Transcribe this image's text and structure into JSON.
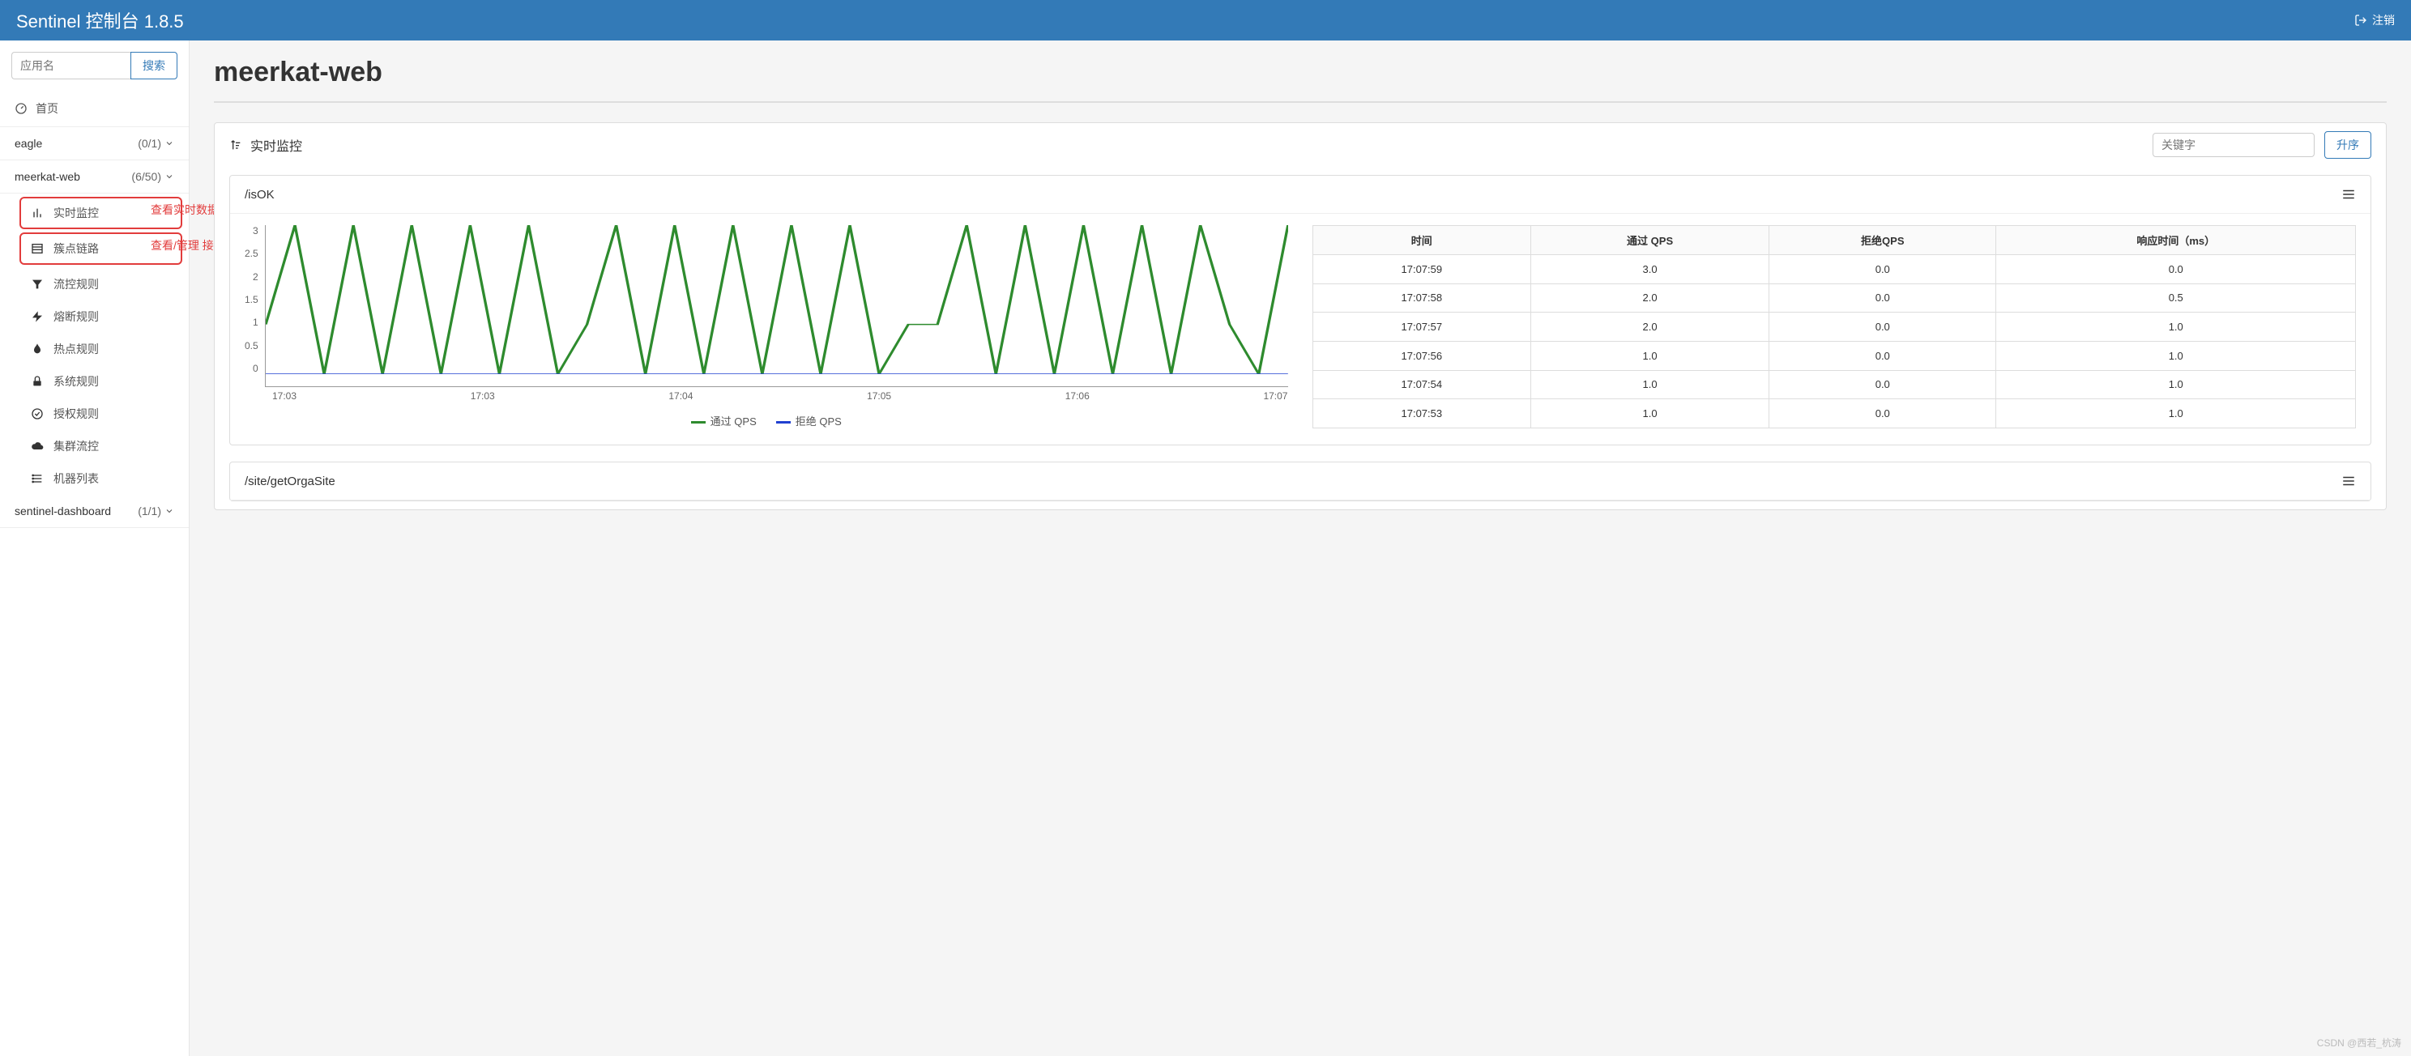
{
  "header": {
    "title": "Sentinel 控制台 1.8.5",
    "register_label": "注销"
  },
  "sidebar": {
    "search_placeholder": "应用名",
    "search_btn": "搜索",
    "home_label": "首页",
    "apps": [
      {
        "name": "eagle",
        "count": "(0/1)"
      },
      {
        "name": "meerkat-web",
        "count": "(6/50)"
      },
      {
        "name": "sentinel-dashboard",
        "count": "(1/1)"
      }
    ],
    "submenu": [
      {
        "icon": "bar-chart",
        "label": "实时监控",
        "hl": true
      },
      {
        "icon": "list",
        "label": "簇点链路",
        "hl": true
      },
      {
        "icon": "filter",
        "label": "流控规则"
      },
      {
        "icon": "flash",
        "label": "熔断规则"
      },
      {
        "icon": "fire",
        "label": "热点规则"
      },
      {
        "icon": "lock",
        "label": "系统规则"
      },
      {
        "icon": "check-circle",
        "label": "授权规则"
      },
      {
        "icon": "cloud",
        "label": "集群流控"
      },
      {
        "icon": "server-list",
        "label": "机器列表"
      }
    ]
  },
  "annotations": {
    "realtime": "查看实时数据",
    "cluster": "查看/管理 接口"
  },
  "page": {
    "title": "meerkat-web"
  },
  "panel": {
    "title": "实时监控",
    "keyword_placeholder": "关键字",
    "sort_label": "升序"
  },
  "card1": {
    "title": "/isOK"
  },
  "card2": {
    "title": "/site/getOrgaSite"
  },
  "table": {
    "headers": [
      "时间",
      "通过 QPS",
      "拒绝QPS",
      "响应时间（ms）"
    ],
    "rows": [
      [
        "17:07:59",
        "3.0",
        "0.0",
        "0.0"
      ],
      [
        "17:07:58",
        "2.0",
        "0.0",
        "0.5"
      ],
      [
        "17:07:57",
        "2.0",
        "0.0",
        "1.0"
      ],
      [
        "17:07:56",
        "1.0",
        "0.0",
        "1.0"
      ],
      [
        "17:07:54",
        "1.0",
        "0.0",
        "1.0"
      ],
      [
        "17:07:53",
        "1.0",
        "0.0",
        "1.0"
      ]
    ]
  },
  "chart_data": {
    "type": "line",
    "title": "/isOK",
    "ylabel": "",
    "xlabel": "",
    "ylim": [
      0,
      3
    ],
    "y_ticks": [
      "3",
      "2.5",
      "2",
      "1.5",
      "1",
      "0.5",
      "0"
    ],
    "x_ticks": [
      "17:03",
      "17:03",
      "17:04",
      "17:05",
      "17:06",
      "17:07"
    ],
    "series": [
      {
        "name": "通过 QPS",
        "color": "#2e8b2e",
        "values": [
          1,
          3,
          0,
          3,
          0,
          3,
          0,
          3,
          0,
          3,
          0,
          1,
          3,
          0,
          3,
          0,
          3,
          0,
          3,
          0,
          3,
          0,
          1,
          1,
          3,
          0,
          3,
          0,
          3,
          0,
          3,
          0,
          3,
          1,
          0,
          3
        ]
      },
      {
        "name": "拒绝 QPS",
        "color": "#2040d0",
        "values": [
          0,
          0,
          0,
          0,
          0,
          0,
          0,
          0,
          0,
          0,
          0,
          0,
          0,
          0,
          0,
          0,
          0,
          0,
          0,
          0,
          0,
          0,
          0,
          0,
          0,
          0,
          0,
          0,
          0,
          0,
          0,
          0,
          0,
          0,
          0,
          0
        ]
      }
    ]
  },
  "legend": {
    "pass": "通过 QPS",
    "reject": "拒绝 QPS"
  },
  "watermark": "CSDN @西若_杭涛"
}
